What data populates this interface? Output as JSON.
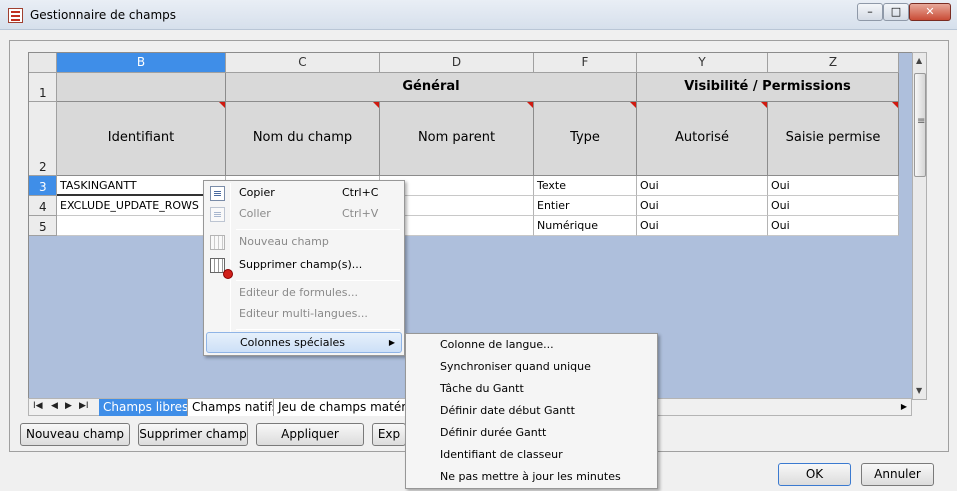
{
  "window": {
    "title": "Gestionnaire de champs",
    "min": "–",
    "max": "□",
    "close": "✕"
  },
  "grid": {
    "columns": [
      "B",
      "C",
      "D",
      "F",
      "Y",
      "Z"
    ],
    "rows": [
      "1",
      "2",
      "3",
      "4",
      "5"
    ],
    "groups": {
      "general": "Général",
      "visibility": "Visibilité / Permissions"
    },
    "field_headers": [
      "Identifiant",
      "Nom du champ",
      "Nom parent",
      "Type",
      "Autorisé",
      "Saisie permise"
    ],
    "data": [
      [
        "TASKINGANTT",
        "",
        "",
        "Texte",
        "Oui",
        "Oui"
      ],
      [
        "EXCLUDE_UPDATE_ROWS",
        "",
        "",
        "Entier",
        "Oui",
        "Oui"
      ],
      [
        "",
        "",
        "",
        "Numérique",
        "Oui",
        "Oui"
      ]
    ]
  },
  "tabs": [
    "Champs libres",
    "Champs natifs",
    "Jeu de champs matérie"
  ],
  "buttons": {
    "new_field": "Nouveau champ",
    "delete_field": "Supprimer champ",
    "apply": "Appliquer",
    "partial": "Exp",
    "ok": "OK",
    "cancel": "Annuler"
  },
  "context_menu": {
    "copy": "Copier",
    "copy_shortcut": "Ctrl+C",
    "paste": "Coller",
    "paste_shortcut": "Ctrl+V",
    "new_field": "Nouveau champ",
    "delete_fields": "Supprimer champ(s)...",
    "formula_editor": "Editeur de formules...",
    "multilang_editor": "Editeur multi-langues...",
    "special_columns": "Colonnes spéciales"
  },
  "submenu": [
    "Colonne de langue...",
    "Synchroniser quand unique",
    "Tâche du Gantt",
    "Définir date début Gantt",
    "Définir durée Gantt",
    "Identifiant de classeur",
    "Ne pas mettre à jour les minutes"
  ]
}
